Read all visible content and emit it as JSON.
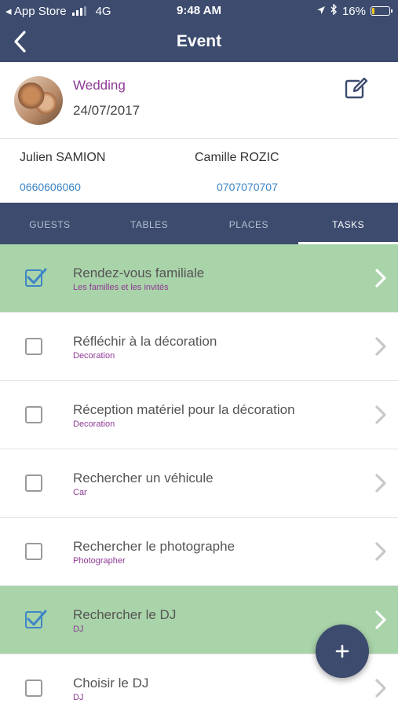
{
  "status_bar": {
    "carrier": "◂ App Store",
    "network": "4G",
    "time": "9:48 AM",
    "battery_percent": "16%",
    "battery_level": 0.16,
    "battery_color": "#f2c81c"
  },
  "header": {
    "title": "Event",
    "back_icon": "chevron-left-icon",
    "background": "#3c4b6e"
  },
  "event": {
    "name": "Wedding",
    "date": "24/07/2017",
    "edit_icon": "edit-icon"
  },
  "contacts": [
    {
      "name": "Julien SAMION",
      "phone": "0660606060"
    },
    {
      "name": "Camille ROZIC",
      "phone": "0707070707"
    }
  ],
  "tabs": [
    {
      "label": "GUESTS",
      "active": false
    },
    {
      "label": "TABLES",
      "active": false
    },
    {
      "label": "PLACES",
      "active": false
    },
    {
      "label": "TASKS",
      "active": true
    }
  ],
  "tasks": [
    {
      "name": "Rendez-vous familiale",
      "category": "Les familles et les invités",
      "done": true
    },
    {
      "name": "Réfléchir à la décoration",
      "category": "Decoration",
      "done": false
    },
    {
      "name": "Réception matériel pour la décoration",
      "category": "Decoration",
      "done": false
    },
    {
      "name": "Rechercher un véhicule",
      "category": "Car",
      "done": false
    },
    {
      "name": "Rechercher le photographe",
      "category": "Photographer",
      "done": false
    },
    {
      "name": "Rechercher le DJ",
      "category": "DJ",
      "done": true
    },
    {
      "name": "Choisir le DJ",
      "category": "DJ",
      "done": false
    }
  ],
  "fab": {
    "label": "+",
    "icon": "plus-icon"
  },
  "colors": {
    "accent": "#8e3a96",
    "link": "#3d86c6",
    "done_row": "#a9d3a9"
  }
}
